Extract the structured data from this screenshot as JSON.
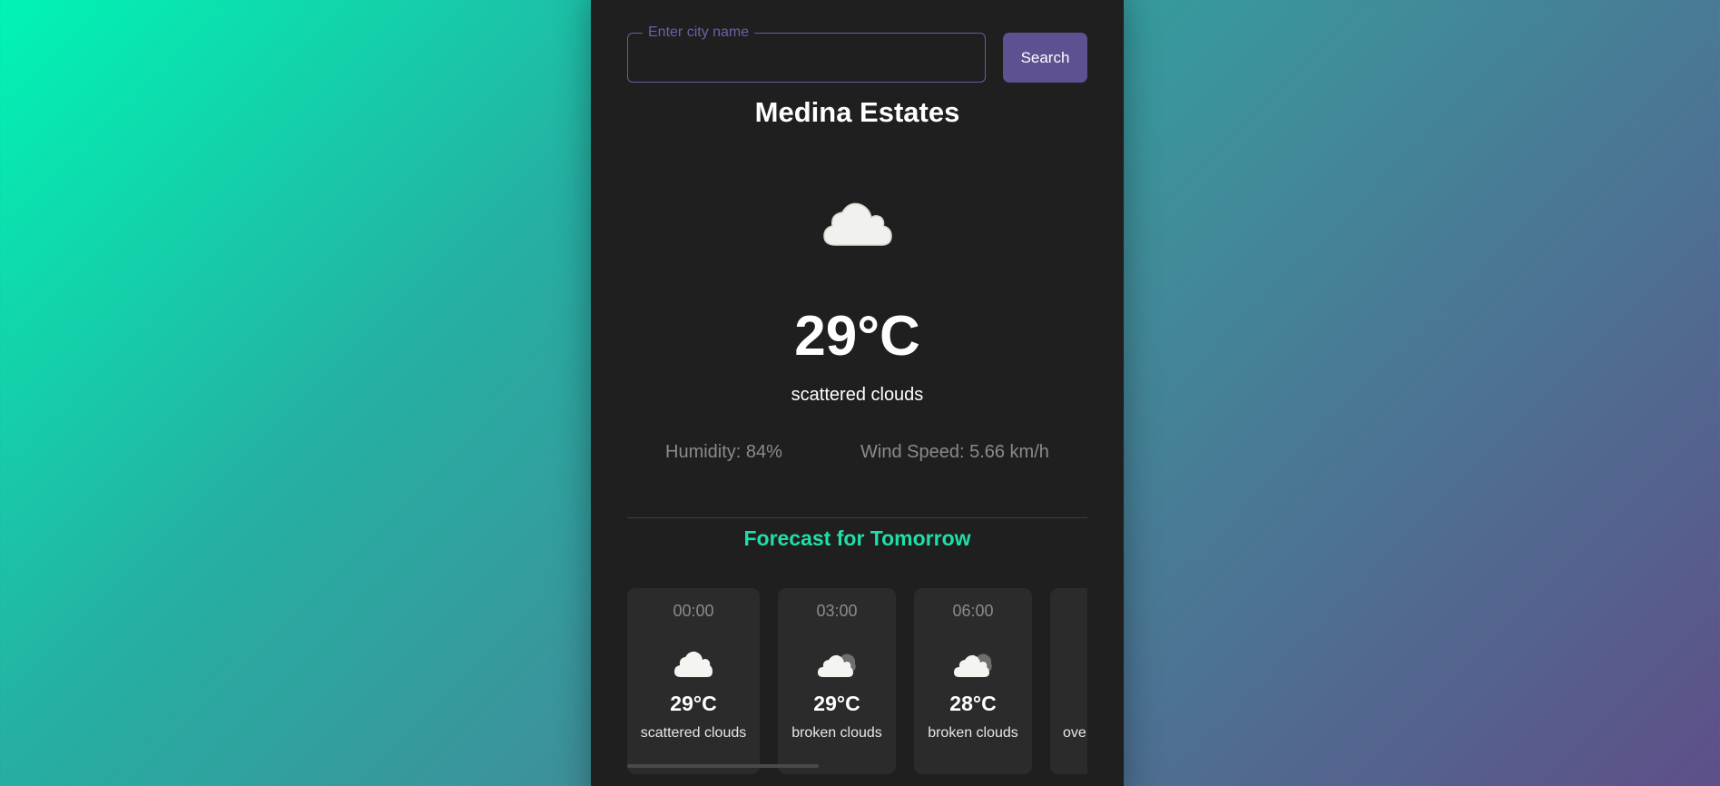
{
  "search": {
    "placeholder": "Enter city name",
    "value": "",
    "button_label": "Search"
  },
  "current": {
    "city": "Medina Estates",
    "icon": "cloud-icon",
    "temperature": "29°C",
    "description": "scattered clouds",
    "humidity": "Humidity: 84%",
    "wind": "Wind Speed: 5.66 km/h"
  },
  "forecast": {
    "title": "Forecast for Tomorrow",
    "items": [
      {
        "time": "00:00",
        "icon": "cloud-icon",
        "temp": "29°C",
        "desc": "scattered clouds"
      },
      {
        "time": "03:00",
        "icon": "broken-clouds-icon",
        "temp": "29°C",
        "desc": "broken clouds"
      },
      {
        "time": "06:00",
        "icon": "broken-clouds-icon",
        "temp": "28°C",
        "desc": "broken clouds"
      },
      {
        "time": "",
        "icon": "",
        "temp": "",
        "desc": "ove"
      }
    ]
  },
  "colors": {
    "accent": "#1fdfa8",
    "button": "#5f5092",
    "card": "#1f1f1f",
    "tile": "#2b2b2b"
  }
}
